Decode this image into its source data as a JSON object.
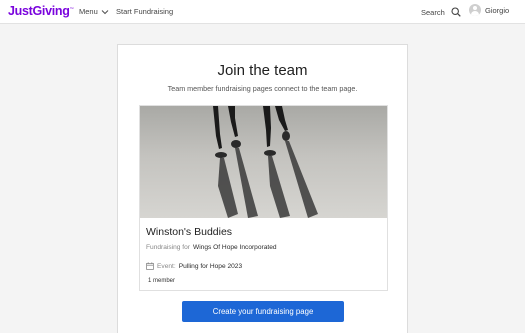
{
  "colors": {
    "brand": "#7a04dd",
    "cta": "#1d67d6",
    "background": "#f4f4f4"
  },
  "header": {
    "logo_text": "JustGiving",
    "logo_tm": "™",
    "menu_label": "Menu",
    "start_fundraising": "Start Fundraising",
    "search_label": "Search",
    "user_name": "Giorgio",
    "icons": [
      "chevron-down-icon",
      "search-icon",
      "user-avatar-icon"
    ]
  },
  "main": {
    "title": "Join the team",
    "subtitle": "Team member fundraising pages connect to the team page.",
    "team": {
      "name": "Winston's Buddies",
      "fundraising_prefix": "Fundraising for",
      "charity": "Wings Of Hope Incorporated",
      "event_prefix": "Event:",
      "event": "Pulling for Hope 2023",
      "members": "1 member",
      "icons": [
        "calendar-icon"
      ]
    },
    "cta_label": "Create your fundraising page"
  }
}
